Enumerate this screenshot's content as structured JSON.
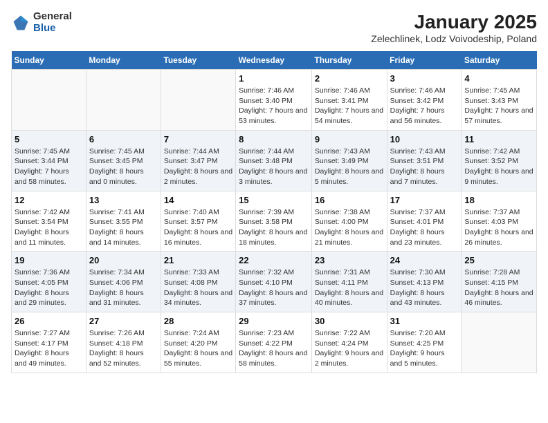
{
  "header": {
    "logo_general": "General",
    "logo_blue": "Blue",
    "title": "January 2025",
    "subtitle": "Zelechlinek, Lodz Voivodeship, Poland"
  },
  "calendar": {
    "weekdays": [
      "Sunday",
      "Monday",
      "Tuesday",
      "Wednesday",
      "Thursday",
      "Friday",
      "Saturday"
    ],
    "weeks": [
      [
        {
          "day": "",
          "info": ""
        },
        {
          "day": "",
          "info": ""
        },
        {
          "day": "",
          "info": ""
        },
        {
          "day": "1",
          "info": "Sunrise: 7:46 AM\nSunset: 3:40 PM\nDaylight: 7 hours and 53 minutes."
        },
        {
          "day": "2",
          "info": "Sunrise: 7:46 AM\nSunset: 3:41 PM\nDaylight: 7 hours and 54 minutes."
        },
        {
          "day": "3",
          "info": "Sunrise: 7:46 AM\nSunset: 3:42 PM\nDaylight: 7 hours and 56 minutes."
        },
        {
          "day": "4",
          "info": "Sunrise: 7:45 AM\nSunset: 3:43 PM\nDaylight: 7 hours and 57 minutes."
        }
      ],
      [
        {
          "day": "5",
          "info": "Sunrise: 7:45 AM\nSunset: 3:44 PM\nDaylight: 7 hours and 58 minutes."
        },
        {
          "day": "6",
          "info": "Sunrise: 7:45 AM\nSunset: 3:45 PM\nDaylight: 8 hours and 0 minutes."
        },
        {
          "day": "7",
          "info": "Sunrise: 7:44 AM\nSunset: 3:47 PM\nDaylight: 8 hours and 2 minutes."
        },
        {
          "day": "8",
          "info": "Sunrise: 7:44 AM\nSunset: 3:48 PM\nDaylight: 8 hours and 3 minutes."
        },
        {
          "day": "9",
          "info": "Sunrise: 7:43 AM\nSunset: 3:49 PM\nDaylight: 8 hours and 5 minutes."
        },
        {
          "day": "10",
          "info": "Sunrise: 7:43 AM\nSunset: 3:51 PM\nDaylight: 8 hours and 7 minutes."
        },
        {
          "day": "11",
          "info": "Sunrise: 7:42 AM\nSunset: 3:52 PM\nDaylight: 8 hours and 9 minutes."
        }
      ],
      [
        {
          "day": "12",
          "info": "Sunrise: 7:42 AM\nSunset: 3:54 PM\nDaylight: 8 hours and 11 minutes."
        },
        {
          "day": "13",
          "info": "Sunrise: 7:41 AM\nSunset: 3:55 PM\nDaylight: 8 hours and 14 minutes."
        },
        {
          "day": "14",
          "info": "Sunrise: 7:40 AM\nSunset: 3:57 PM\nDaylight: 8 hours and 16 minutes."
        },
        {
          "day": "15",
          "info": "Sunrise: 7:39 AM\nSunset: 3:58 PM\nDaylight: 8 hours and 18 minutes."
        },
        {
          "day": "16",
          "info": "Sunrise: 7:38 AM\nSunset: 4:00 PM\nDaylight: 8 hours and 21 minutes."
        },
        {
          "day": "17",
          "info": "Sunrise: 7:37 AM\nSunset: 4:01 PM\nDaylight: 8 hours and 23 minutes."
        },
        {
          "day": "18",
          "info": "Sunrise: 7:37 AM\nSunset: 4:03 PM\nDaylight: 8 hours and 26 minutes."
        }
      ],
      [
        {
          "day": "19",
          "info": "Sunrise: 7:36 AM\nSunset: 4:05 PM\nDaylight: 8 hours and 29 minutes."
        },
        {
          "day": "20",
          "info": "Sunrise: 7:34 AM\nSunset: 4:06 PM\nDaylight: 8 hours and 31 minutes."
        },
        {
          "day": "21",
          "info": "Sunrise: 7:33 AM\nSunset: 4:08 PM\nDaylight: 8 hours and 34 minutes."
        },
        {
          "day": "22",
          "info": "Sunrise: 7:32 AM\nSunset: 4:10 PM\nDaylight: 8 hours and 37 minutes."
        },
        {
          "day": "23",
          "info": "Sunrise: 7:31 AM\nSunset: 4:11 PM\nDaylight: 8 hours and 40 minutes."
        },
        {
          "day": "24",
          "info": "Sunrise: 7:30 AM\nSunset: 4:13 PM\nDaylight: 8 hours and 43 minutes."
        },
        {
          "day": "25",
          "info": "Sunrise: 7:28 AM\nSunset: 4:15 PM\nDaylight: 8 hours and 46 minutes."
        }
      ],
      [
        {
          "day": "26",
          "info": "Sunrise: 7:27 AM\nSunset: 4:17 PM\nDaylight: 8 hours and 49 minutes."
        },
        {
          "day": "27",
          "info": "Sunrise: 7:26 AM\nSunset: 4:18 PM\nDaylight: 8 hours and 52 minutes."
        },
        {
          "day": "28",
          "info": "Sunrise: 7:24 AM\nSunset: 4:20 PM\nDaylight: 8 hours and 55 minutes."
        },
        {
          "day": "29",
          "info": "Sunrise: 7:23 AM\nSunset: 4:22 PM\nDaylight: 8 hours and 58 minutes."
        },
        {
          "day": "30",
          "info": "Sunrise: 7:22 AM\nSunset: 4:24 PM\nDaylight: 9 hours and 2 minutes."
        },
        {
          "day": "31",
          "info": "Sunrise: 7:20 AM\nSunset: 4:25 PM\nDaylight: 9 hours and 5 minutes."
        },
        {
          "day": "",
          "info": ""
        }
      ]
    ]
  }
}
